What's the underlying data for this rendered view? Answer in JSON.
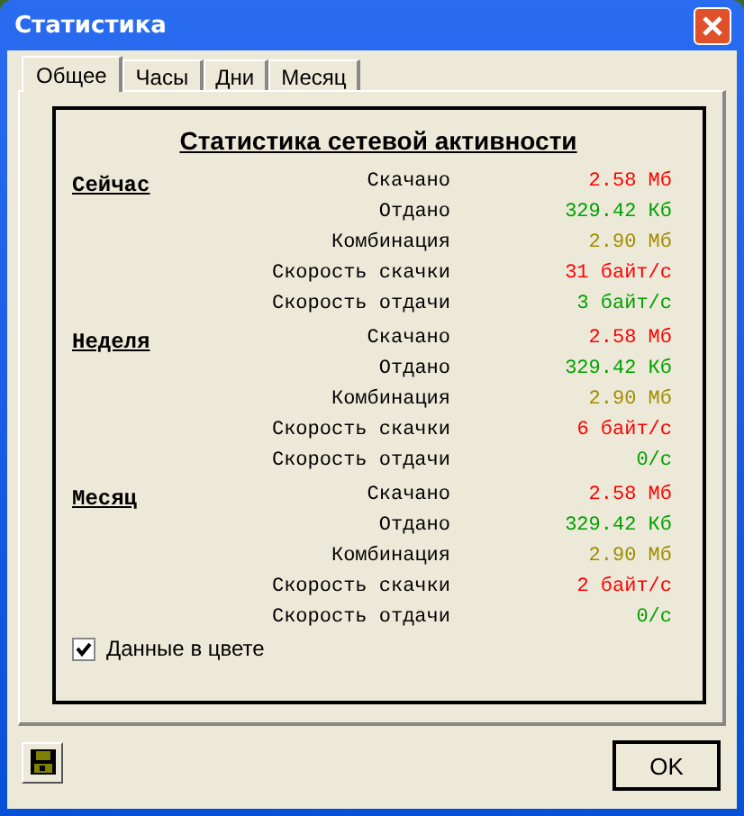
{
  "window": {
    "title": "Статистика"
  },
  "tabs": [
    {
      "label": "Общее",
      "selected": true
    },
    {
      "label": "Часы",
      "selected": false
    },
    {
      "label": "Дни",
      "selected": false
    },
    {
      "label": "Месяц",
      "selected": false
    }
  ],
  "heading": "Статистика сетевой активности",
  "sections": [
    {
      "title": "Сейчас",
      "rows": [
        {
          "label": "Скачано",
          "value": "2.58 Мб",
          "color": "#ff0000"
        },
        {
          "label": "Отдано",
          "value": "329.42 Кб",
          "color": "#00a000"
        },
        {
          "label": "Комбинация",
          "value": "2.90 Мб",
          "color": "#a08c00"
        },
        {
          "label": "Скорость скачки",
          "value": "31 байт/с",
          "color": "#ff0000"
        },
        {
          "label": "Скорость отдачи",
          "value": "3 байт/с",
          "color": "#00a000"
        }
      ]
    },
    {
      "title": "Неделя",
      "rows": [
        {
          "label": "Скачано",
          "value": "2.58 Мб",
          "color": "#ff0000"
        },
        {
          "label": "Отдано",
          "value": "329.42 Кб",
          "color": "#00a000"
        },
        {
          "label": "Комбинация",
          "value": "2.90 Мб",
          "color": "#a08c00"
        },
        {
          "label": "Скорость скачки",
          "value": "6 байт/с",
          "color": "#ff0000"
        },
        {
          "label": "Скорость отдачи",
          "value": "0/с",
          "color": "#00a000"
        }
      ]
    },
    {
      "title": "Месяц",
      "rows": [
        {
          "label": "Скачано",
          "value": "2.58 Мб",
          "color": "#ff0000"
        },
        {
          "label": "Отдано",
          "value": "329.42 Кб",
          "color": "#00a000"
        },
        {
          "label": "Комбинация",
          "value": "2.90 Мб",
          "color": "#a08c00"
        },
        {
          "label": "Скорость скачки",
          "value": "2 байт/с",
          "color": "#ff0000"
        },
        {
          "label": "Скорость отдачи",
          "value": "0/с",
          "color": "#00a000"
        }
      ]
    }
  ],
  "color_checkbox": {
    "label": "Данные в цвете",
    "checked": true
  },
  "ok_button": "OK"
}
